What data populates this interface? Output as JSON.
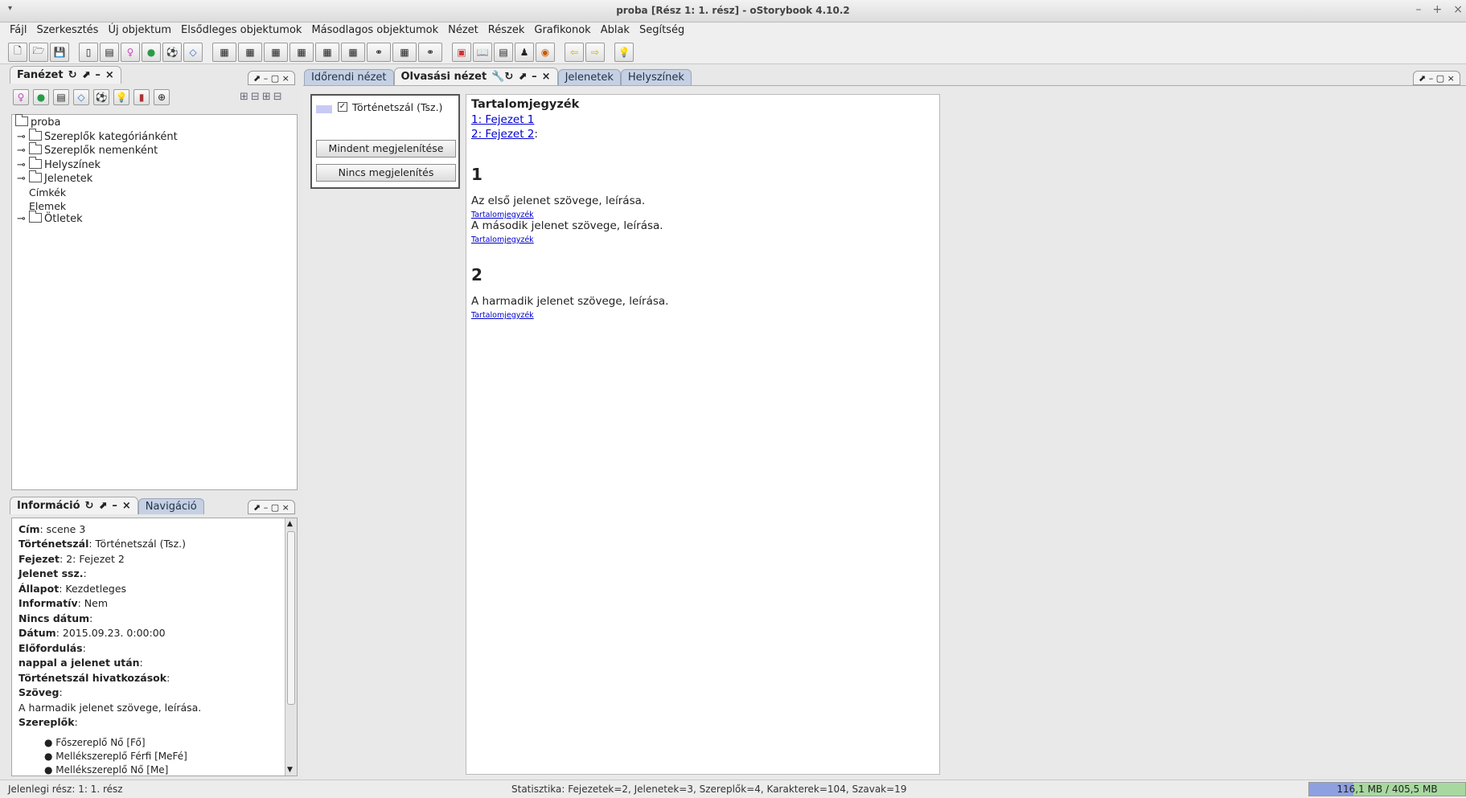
{
  "window": {
    "title": "proba [Rész 1: 1. rész] - oStorybook 4.10.2",
    "controls": [
      "–",
      "+",
      "×"
    ]
  },
  "menu": [
    "Fájl",
    "Szerkesztés",
    "Új objektum",
    "Elsődleges objektumok",
    "Másodlagos objektumok",
    "Nézet",
    "Részek",
    "Grafikonok",
    "Ablak",
    "Segítség"
  ],
  "toolbar_icons": [
    "new-file-icon",
    "open-folder-icon",
    "save-icon",
    "chapter-icon",
    "scene-icon",
    "person-icon",
    "location-icon",
    "item-icon",
    "tag-icon",
    "chapters-table-icon",
    "scenes-table-icon",
    "persons-table-icon",
    "gender-table-icon",
    "locations-table-icon",
    "items-table-icon",
    "itemlinks-icon",
    "tags-table-icon",
    "taglinks-icon",
    "calendar-icon",
    "book-icon",
    "memo-icon",
    "reading-icon",
    "chrono-icon",
    "back-arrow-icon",
    "forward-arrow-icon",
    "idea-icon"
  ],
  "tree_panel": {
    "tab": "Fanézet",
    "root": "proba",
    "items": [
      {
        "label": "Szereplők kategóriánként",
        "folder": true
      },
      {
        "label": "Szereplők nemenként",
        "folder": true
      },
      {
        "label": "Helyszínek",
        "folder": true
      },
      {
        "label": "Jelenetek",
        "folder": true
      },
      {
        "label": "Címkék",
        "folder": false
      },
      {
        "label": "Elemek",
        "folder": false
      },
      {
        "label": "Ötletek",
        "folder": true
      }
    ]
  },
  "info_panel": {
    "tabs": [
      "Információ",
      "Navigáció"
    ],
    "lines": [
      {
        "k": "Cím",
        "v": ": scene 3"
      },
      {
        "k": "Történetszál",
        "v": ": Történetszál (Tsz.)"
      },
      {
        "k": "Fejezet",
        "v": ": 2: Fejezet 2"
      },
      {
        "k": "Jelenet ssz.",
        "v": ":"
      },
      {
        "k": "Állapot",
        "v": ": Kezdetleges"
      },
      {
        "k": "Informatív",
        "v": ": Nem"
      },
      {
        "k": "Nincs dátum",
        "v": ":"
      },
      {
        "k": "Dátum",
        "v": ": 2015.09.23. 0:00:00"
      },
      {
        "k": "Előfordulás",
        "v": ":"
      },
      {
        "k": "nappal a jelenet után",
        "v": ":"
      },
      {
        "k": "Történetszál hivatkozások",
        "v": ":"
      },
      {
        "k": "Szöveg",
        "v": ":"
      },
      {
        "k": "",
        "v": "A harmadik jelenet szövege, leírása."
      },
      {
        "k": "Szereplők",
        "v": ":"
      }
    ],
    "persons": [
      "Főszereplő Nő [Fő]",
      "Mellékszereplő Férfi [MeFé]",
      "Mellékszereplő Nő [Me]"
    ]
  },
  "view_tabs": [
    "Időrendi nézet",
    "Olvasási nézet",
    "Jelenetek",
    "Helyszínek"
  ],
  "filter": {
    "strand": "Történetszál (Tsz.)",
    "checked": true,
    "show_all": "Mindent megjelenítése",
    "show_none": "Nincs megjelenítés"
  },
  "reading": {
    "toc_title": "Tartalomjegyzék",
    "toc": [
      "1: Fejezet 1",
      "2: Fejezet 2"
    ],
    "toc_suffix": ":",
    "ch1": "1",
    "scene1": "Az első jelenet szövege, leírása.",
    "scene2": "A második jelenet szövege, leírása.",
    "ch2": "2",
    "scene3": "A harmadik jelenet szövege, leírása.",
    "back": "Tartalomjegyzék"
  },
  "status": {
    "part": "Jelenlegi rész: 1: 1. rész",
    "stats": "Statisztika: Fejezetek=2,  Jelenetek=3,  Szereplők=4,  Karakterek=104,  Szavak=19",
    "memory": "116,1 MB / 405,5 MB",
    "memory_fraction": 0.286
  }
}
